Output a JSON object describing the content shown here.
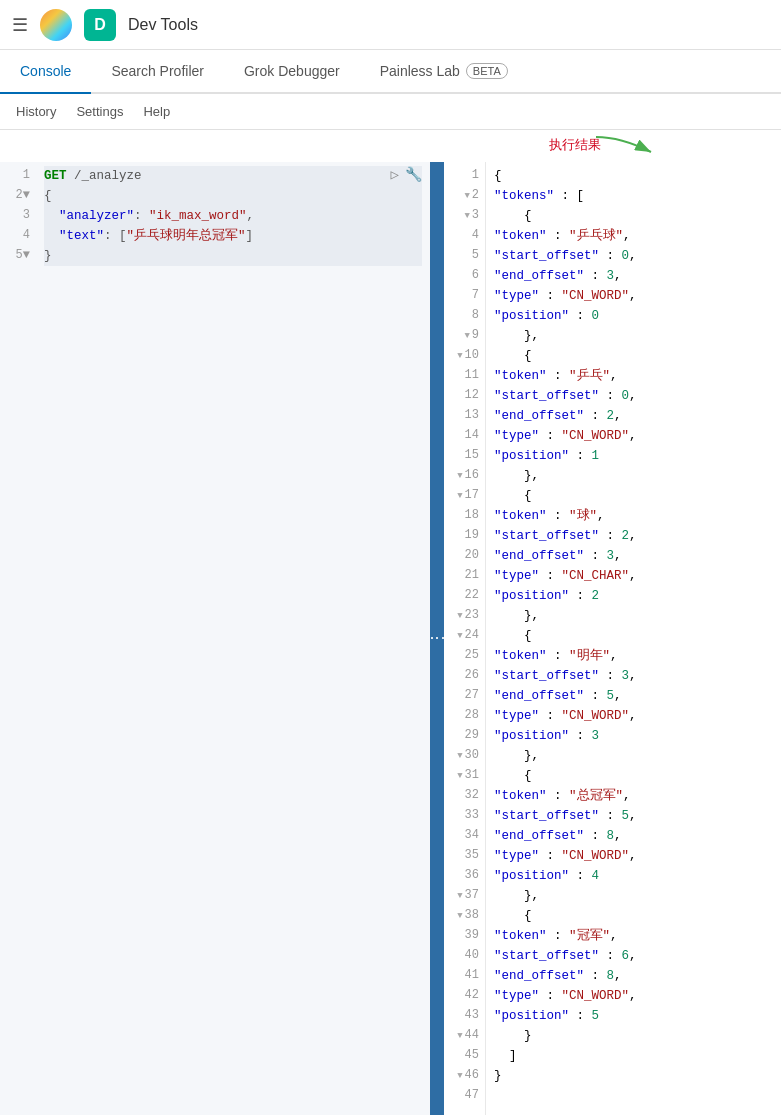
{
  "topbar": {
    "menu_icon": "☰",
    "logo_text": "",
    "avatar_letter": "D",
    "app_title": "Dev Tools"
  },
  "nav": {
    "tabs": [
      {
        "label": "Console",
        "active": true
      },
      {
        "label": "Search Profiler",
        "active": false
      },
      {
        "label": "Grok Debugger",
        "active": false
      },
      {
        "label": "Painless Lab",
        "active": false,
        "badge": "BETA"
      }
    ]
  },
  "subheader": {
    "items": [
      "History",
      "Settings",
      "Help"
    ]
  },
  "annotation": {
    "text": "执行结果"
  },
  "editor": {
    "lines": [
      {
        "num": "1",
        "content": "GET /_analyze",
        "highlight": true
      },
      {
        "num": "2",
        "content": "{",
        "highlight": true
      },
      {
        "num": "3",
        "content": "  \"analyzer\": \"ik_max_word\",",
        "highlight": true
      },
      {
        "num": "4",
        "content": "  \"text\": [\"乒乓球明年总冠军\"]",
        "highlight": true
      },
      {
        "num": "5",
        "content": "}",
        "highlight": true
      }
    ]
  },
  "result": {
    "lines": [
      {
        "num": "1",
        "content": "{",
        "collapse": false
      },
      {
        "num": "2",
        "content": "  \"tokens\" : [",
        "collapse": true
      },
      {
        "num": "3",
        "content": "    {",
        "collapse": true
      },
      {
        "num": "4",
        "content": "      \"token\" : \"乒乓球\",",
        "collapse": false
      },
      {
        "num": "5",
        "content": "      \"start_offset\" : 0,",
        "collapse": false
      },
      {
        "num": "6",
        "content": "      \"end_offset\" : 3,",
        "collapse": false
      },
      {
        "num": "7",
        "content": "      \"type\" : \"CN_WORD\",",
        "collapse": false
      },
      {
        "num": "8",
        "content": "      \"position\" : 0",
        "collapse": false
      },
      {
        "num": "9",
        "content": "    },",
        "collapse": true
      },
      {
        "num": "10",
        "content": "    {",
        "collapse": true
      },
      {
        "num": "11",
        "content": "      \"token\" : \"乒乓\",",
        "collapse": false
      },
      {
        "num": "12",
        "content": "      \"start_offset\" : 0,",
        "collapse": false
      },
      {
        "num": "13",
        "content": "      \"end_offset\" : 2,",
        "collapse": false
      },
      {
        "num": "14",
        "content": "      \"type\" : \"CN_WORD\",",
        "collapse": false
      },
      {
        "num": "15",
        "content": "      \"position\" : 1",
        "collapse": false
      },
      {
        "num": "16",
        "content": "    },",
        "collapse": true
      },
      {
        "num": "17",
        "content": "    {",
        "collapse": true
      },
      {
        "num": "18",
        "content": "      \"token\" : \"球\",",
        "collapse": false
      },
      {
        "num": "19",
        "content": "      \"start_offset\" : 2,",
        "collapse": false
      },
      {
        "num": "20",
        "content": "      \"end_offset\" : 3,",
        "collapse": false
      },
      {
        "num": "21",
        "content": "      \"type\" : \"CN_CHAR\",",
        "collapse": false
      },
      {
        "num": "22",
        "content": "      \"position\" : 2",
        "collapse": false
      },
      {
        "num": "23",
        "content": "    },",
        "collapse": true
      },
      {
        "num": "24",
        "content": "    {",
        "collapse": true
      },
      {
        "num": "25",
        "content": "      \"token\" : \"明年\",",
        "collapse": false
      },
      {
        "num": "26",
        "content": "      \"start_offset\" : 3,",
        "collapse": false
      },
      {
        "num": "27",
        "content": "      \"end_offset\" : 5,",
        "collapse": false
      },
      {
        "num": "28",
        "content": "      \"type\" : \"CN_WORD\",",
        "collapse": false
      },
      {
        "num": "29",
        "content": "      \"position\" : 3",
        "collapse": false
      },
      {
        "num": "30",
        "content": "    },",
        "collapse": true
      },
      {
        "num": "31",
        "content": "    {",
        "collapse": true
      },
      {
        "num": "32",
        "content": "      \"token\" : \"总冠军\",",
        "collapse": false
      },
      {
        "num": "33",
        "content": "      \"start_offset\" : 5,",
        "collapse": false
      },
      {
        "num": "34",
        "content": "      \"end_offset\" : 8,",
        "collapse": false
      },
      {
        "num": "35",
        "content": "      \"type\" : \"CN_WORD\",",
        "collapse": false
      },
      {
        "num": "36",
        "content": "      \"position\" : 4",
        "collapse": false
      },
      {
        "num": "37",
        "content": "    },",
        "collapse": true
      },
      {
        "num": "38",
        "content": "    {",
        "collapse": true
      },
      {
        "num": "39",
        "content": "      \"token\" : \"冠军\",",
        "collapse": false
      },
      {
        "num": "40",
        "content": "      \"start_offset\" : 6,",
        "collapse": false
      },
      {
        "num": "41",
        "content": "      \"end_offset\" : 8,",
        "collapse": false
      },
      {
        "num": "42",
        "content": "      \"type\" : \"CN_WORD\",",
        "collapse": false
      },
      {
        "num": "43",
        "content": "      \"position\" : 5",
        "collapse": false
      },
      {
        "num": "44",
        "content": "    }",
        "collapse": true
      },
      {
        "num": "45",
        "content": "  ]",
        "collapse": false
      },
      {
        "num": "46",
        "content": "}",
        "collapse": true
      },
      {
        "num": "47",
        "content": "",
        "collapse": false
      }
    ]
  }
}
